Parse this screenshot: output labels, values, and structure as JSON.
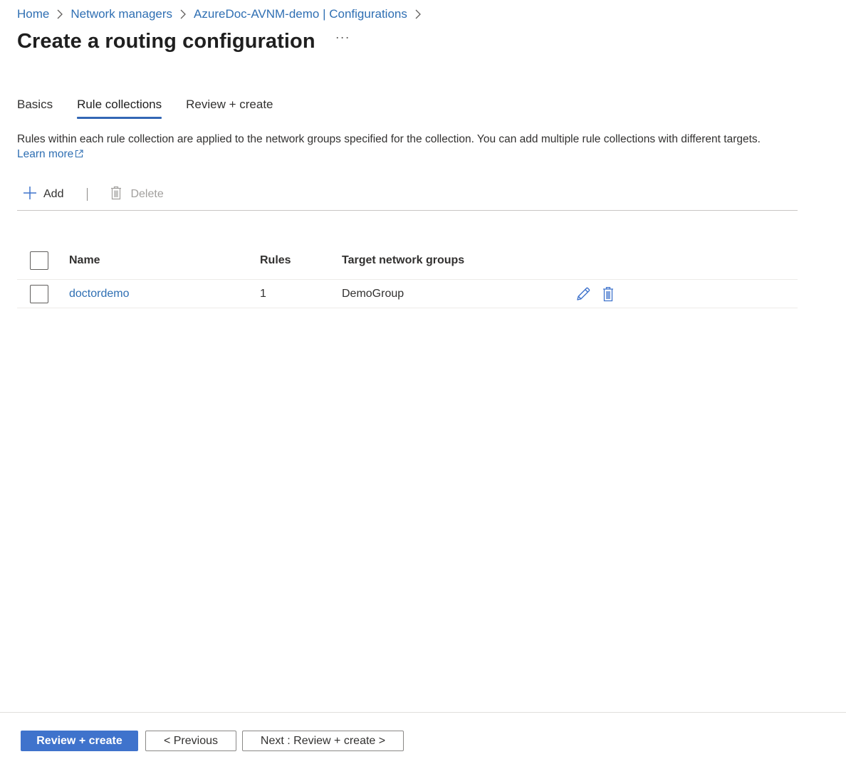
{
  "breadcrumb": {
    "items": [
      "Home",
      "Network managers",
      "AzureDoc-AVNM-demo | Configurations"
    ]
  },
  "page": {
    "title": "Create a routing configuration",
    "more": "···"
  },
  "tabs": [
    {
      "label": "Basics",
      "active": false
    },
    {
      "label": "Rule collections",
      "active": true
    },
    {
      "label": "Review + create",
      "active": false
    }
  ],
  "description": {
    "text": "Rules within each rule collection are applied to the network groups specified for the collection. You can add multiple rule collections with different targets.",
    "link": "Learn more"
  },
  "toolbar": {
    "add_label": "Add",
    "delete_label": "Delete"
  },
  "table": {
    "columns": [
      "Name",
      "Rules",
      "Target network groups"
    ],
    "rows": [
      {
        "name": "doctordemo",
        "rules": "1",
        "target": "DemoGroup"
      }
    ]
  },
  "footer": {
    "review_create_label": "Review + create",
    "previous_label": "< Previous",
    "next_label": "Next : Review + create >"
  },
  "colors": {
    "accent": "#3f73cc",
    "link": "#2f6fb3",
    "tab_underline": "#3367b5"
  },
  "icons": [
    "chevron-right-icon",
    "more-icon",
    "external-link-icon",
    "plus-icon",
    "trash-icon",
    "edit-pencil-icon"
  ]
}
